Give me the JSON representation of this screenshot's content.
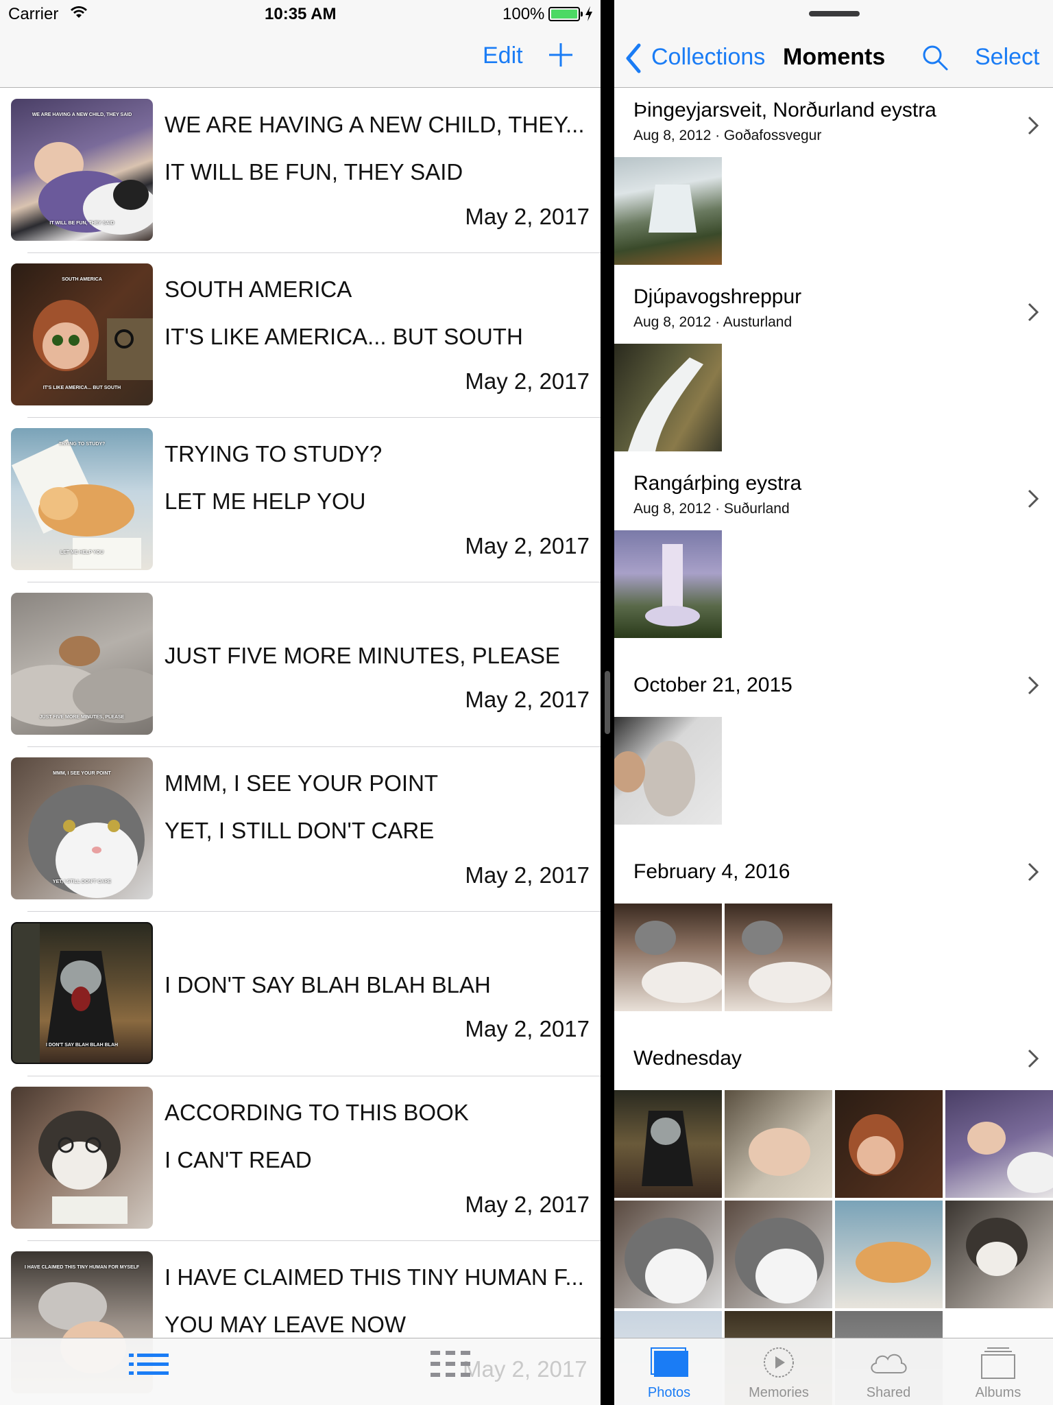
{
  "status_bar": {
    "carrier": "Carrier",
    "time": "10:35 AM",
    "battery": "100%"
  },
  "left_nav": {
    "edit_label": "Edit"
  },
  "memes": [
    {
      "top": "WE ARE HAVING A NEW CHILD, THEY...",
      "bottom": "IT WILL BE FUN, THEY SAID",
      "date": "May 2, 2017",
      "thumb_top": "WE ARE HAVING A NEW CHILD, THEY SAID",
      "thumb_bottom": "IT WILL BE FUN, THEY SAID"
    },
    {
      "top": "SOUTH AMERICA",
      "bottom": "IT'S LIKE AMERICA... BUT SOUTH",
      "date": "May 2, 2017",
      "thumb_top": "SOUTH AMERICA",
      "thumb_bottom": "IT'S LIKE AMERICA... BUT SOUTH"
    },
    {
      "top": "TRYING TO STUDY?",
      "bottom": "LET ME HELP YOU",
      "date": "May 2, 2017",
      "thumb_top": "TRYING TO STUDY?",
      "thumb_bottom": "LET ME HELP YOU"
    },
    {
      "top": "",
      "bottom": "JUST FIVE MORE MINUTES, PLEASE",
      "date": "May 2, 2017",
      "thumb_top": "",
      "thumb_bottom": "JUST FIVE MORE MINUTES, PLEASE"
    },
    {
      "top": "MMM, I SEE YOUR POINT",
      "bottom": "YET, I STILL DON'T CARE",
      "date": "May 2, 2017",
      "thumb_top": "MMM, I SEE YOUR POINT",
      "thumb_bottom": "YET, I STILL DON'T CARE"
    },
    {
      "top": "",
      "bottom": "I DON'T SAY BLAH BLAH BLAH",
      "date": "May 2, 2017",
      "thumb_top": "",
      "thumb_bottom": "I DON'T SAY BLAH BLAH BLAH"
    },
    {
      "top": "ACCORDING TO THIS BOOK",
      "bottom": "I CAN'T READ",
      "date": "May 2, 2017",
      "thumb_top": "",
      "thumb_bottom": ""
    },
    {
      "top": "I HAVE CLAIMED THIS TINY HUMAN F...",
      "bottom": "YOU MAY LEAVE NOW",
      "date": "",
      "thumb_top": "I HAVE CLAIMED THIS TINY HUMAN FOR MYSELF",
      "thumb_bottom": ""
    }
  ],
  "left_tabbar": {
    "ghost_date": "May 2, 2017"
  },
  "right_nav": {
    "back_label": "Collections",
    "title": "Moments",
    "select_label": "Select"
  },
  "moments": [
    {
      "place": "Þingeyjarsveit, Norðurland eystra",
      "sub": "Aug 8, 2012 · Goðafossvegur",
      "photos": [
        "waterfall-1"
      ]
    },
    {
      "place": "Djúpavogshreppur",
      "sub": "Aug 8, 2012 · Austurland",
      "photos": [
        "waterfall-2"
      ]
    },
    {
      "place": "Rangárþing eystra",
      "sub": "Aug 8, 2012 · Suðurland",
      "photos": [
        "waterfall-3"
      ]
    },
    {
      "place": "October 21, 2015",
      "sub": "",
      "photos": [
        "cat-keyboard"
      ]
    },
    {
      "place": "February 4, 2016",
      "sub": "",
      "photos": [
        "cat-dog-1",
        "cat-dog-2"
      ]
    },
    {
      "place": "Wednesday",
      "sub": "",
      "photos": [
        "blah",
        "baby-cat",
        "south-america",
        "baby-husky",
        "cat-grey-1",
        "cat-grey-2",
        "cat-study",
        "husky-book",
        "screen",
        "dark",
        "grey"
      ]
    }
  ],
  "right_tabbar": {
    "tabs": [
      "Photos",
      "Memories",
      "Shared",
      "Albums"
    ],
    "active": "Photos"
  },
  "colors": {
    "accent": "#1a7cf5",
    "battery": "#4cd964",
    "tab_inactive": "#929292"
  }
}
